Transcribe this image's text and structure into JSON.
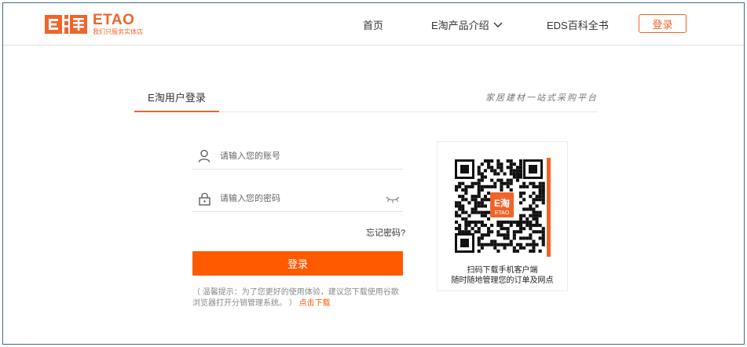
{
  "brand": {
    "mark": "E淘",
    "title": "ETAO",
    "slogan": "我们只服务实体店",
    "color": "#f0642a"
  },
  "nav": {
    "home": "首页",
    "products": "E淘产品介绍",
    "eds": "EDS百科全书",
    "login": "登录"
  },
  "login_form": {
    "tab": "E淘用户登录",
    "tagline": "家居建材一站式采购平台",
    "account_placeholder": "请输入您的账号",
    "password_placeholder": "请输入您的密码",
    "forgot": "忘记密码?",
    "submit": "登录",
    "notice_prefix": "（ 温馨提示：为了您更好的使用体验，建议您下载使用谷歌浏览器打开分销管理系统。 ）",
    "notice_link": "点击下载"
  },
  "qr": {
    "line1": "扫码下载手机客户端",
    "line2": "随时随地管理您的订单及网点",
    "center_mark": "E淘",
    "center_text": "ETAO"
  },
  "colors": {
    "accent": "#ff5a00",
    "border": "#3d6d8e"
  }
}
